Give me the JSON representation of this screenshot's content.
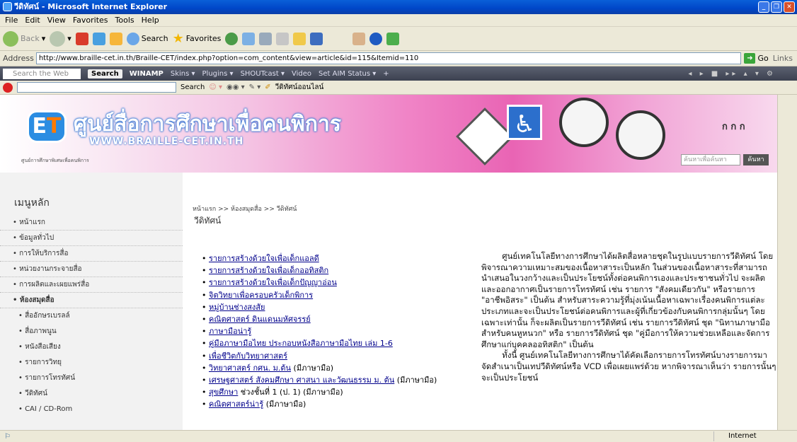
{
  "window": {
    "title": "วีดิทัศน์ - Microsoft Internet Explorer"
  },
  "menubar": [
    "File",
    "Edit",
    "View",
    "Favorites",
    "Tools",
    "Help"
  ],
  "toolbar": {
    "back": "Back",
    "search": "Search",
    "favorites": "Favorites"
  },
  "address": {
    "label": "Address",
    "url": "http://www.braille-cet.in.th/Braille-CET/index.php?option=com_content&view=article&id=115&Itemid=110",
    "go": "Go",
    "links": "Links"
  },
  "aim_bar": {
    "search_placeholder": "Search the Web",
    "search_button": "Search",
    "winamp": "WINAMP",
    "items": [
      "Skins ▾",
      "Plugins ▾",
      "SHOUTcast ▾",
      "Video",
      "Set AIM Status ▾",
      "+"
    ]
  },
  "google_bar": {
    "search": "Search",
    "extra": "วีดิทัศน์ออนไลน์"
  },
  "banner": {
    "title": "ศูนย์สื่อการศึกษาเพื่อคนพิการ",
    "subtitle": "WWW.BRAILLE-CET.IN.TH",
    "small": "ศูนย์การศึกษาพิเศษเพื่อคนพิการ",
    "font_size_label": "ก ก ก",
    "search_placeholder": "ค้นหาเพื่อค้นหา",
    "search_button": "ค้นหา"
  },
  "sidebar": {
    "heading": "เมนูหลัก",
    "items": [
      {
        "label": "• หน้าแรก",
        "type": "top"
      },
      {
        "label": "• ข้อมูลทั่วไป",
        "type": "top"
      },
      {
        "label": "• การให้บริการสื่อ",
        "type": "top"
      },
      {
        "label": "• หน่วยงานกระจายสื่อ",
        "type": "top"
      },
      {
        "label": "• การผลิตและเผยแพร่สื่อ",
        "type": "top"
      },
      {
        "label": "• ห้องสมุดสื่อ",
        "type": "bold"
      },
      {
        "label": "• สื่ออักษรเบรลล์",
        "type": "sub"
      },
      {
        "label": "• สื่อภาพนูน",
        "type": "sub"
      },
      {
        "label": "• หนังสือเสียง",
        "type": "sub"
      },
      {
        "label": "• รายการวิทยุ",
        "type": "sub"
      },
      {
        "label": "• รายการโทรทัศน์",
        "type": "sub"
      },
      {
        "label": "• วีดิทัศน์",
        "type": "sub"
      },
      {
        "label": "• CAI / CD-Rom",
        "type": "sub"
      }
    ]
  },
  "breadcrumb": "หน้าแรก >> ห้องสมุดสื่อ >> วีดิทัศน์",
  "page_title": "วีดิทัศน์",
  "video_list": [
    {
      "link": "รายการสร้างด้วยใจเพื่อเด็กแอลดี",
      "tail": ""
    },
    {
      "link": "รายการสร้างด้วยใจเพื่อเด็กออทิสติก",
      "tail": ""
    },
    {
      "link": "รายการสร้างด้วยใจเพื่อเด็กปัญญาอ่อน",
      "tail": ""
    },
    {
      "link": "จิตวิทยาเพื่อครอบครัวเด็กพิการ",
      "tail": ""
    },
    {
      "link": "หมู่บ้านช่างสงสัย",
      "tail": ""
    },
    {
      "link": "คณิตศาสตร์ ดินแดนมหัศจรรย์",
      "tail": ""
    },
    {
      "link": "ภาษามือน่ารู้",
      "tail": ""
    },
    {
      "link": "คู่มือภาษามือไทย ประกอบหนังสือภาษามือไทย เล่ม 1-6",
      "tail": ""
    },
    {
      "link": "เพื่อชีวิตกับวิทยาศาสตร์",
      "tail": ""
    },
    {
      "link": "วิทยาศาสตร์ กศน. ม.ต้น",
      "tail": " (มีภาษามือ)"
    },
    {
      "link": "เศรษฐศาสตร์ สังคมศึกษา ศาสนา และวัฒนธรรม ม. ต้น",
      "tail": " (มีภาษามือ)"
    },
    {
      "link": "สุขศึกษา",
      "tail": " ช่วงชั้นที่ 1 (ป. 1) (มีภาษามือ)"
    },
    {
      "link": "คณิตศาสตร์น่ารู้",
      "tail": " (มีภาษามือ)"
    }
  ],
  "description": [
    "        ศูนย์เทคโนโลยีทางการศึกษาได้ผลิตสื่อหลายชุดในรูปแบบรายการวีดิทัศน์ โดยพิจารณาความเหมาะสมของเนื้อหาสาระเป็นหลัก ในส่วนของเนื้อหาสาระที่สามารถนำเสนอในวงกว้างและเป็นประโยชน์ทั้งต่อคนพิการเองและประชาชนทั่วไป จะผลิตและออกอากาศเป็นรายการโทรทัศน์ เช่น รายการ \"สังคมเดียวกัน\" หรือรายการ \"อาชีพอิสระ\" เป็นต้น สำหรับสาระความรู้ที่มุ่งเน้นเนื้อหาเฉพาะเรื่องคนพิการแต่ละประเภทและจะเป็นประโยชน์ต่อคนพิการและผู้ที่เกี่ยวข้องกับคนพิการกลุ่มนั้นๆ โดยเฉพาะเท่านั้น ก็จะผลิตเป็นรายการวีดิทัศน์ เช่น รายการวีดิทัศน์ ชุด \"นิทานภาษามือสำหรับคนหูหนวก\" หรือ รายการวีดิทัศน์ ชุด \"คู่มือการให้ความช่วยเหลือและจัดการศึกษาแก่บุคคลออทิสติก\" เป็นต้น",
    "        ทั้งนี้ ศูนย์เทคโนโลยีทางการศึกษาได้คัดเลือกรายการโทรทัศน์บางรายการมาจัดสำเนาเป็นเทปวีดิทัศน์หรือ VCD เพื่อเผยแพร่ด้วย หากพิจารณาเห็นว่า รายการนั้นๆ จะเป็นประโยชน์"
  ],
  "status": {
    "zone": "Internet"
  }
}
